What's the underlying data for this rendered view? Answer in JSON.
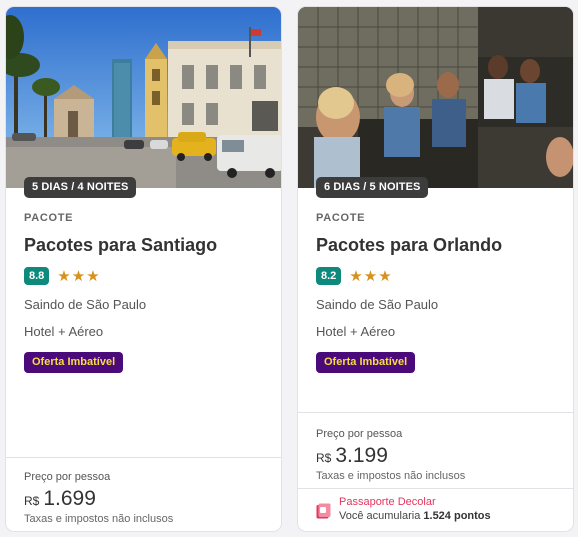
{
  "cards": [
    {
      "duration": "5 DIAS / 4 NOITES",
      "type_label": "PACOTE",
      "title": "Pacotes para Santiago",
      "score": "8.8",
      "stars": "★★★",
      "origin": "Saindo de São Paulo",
      "lodging": "Hotel + Aéreo",
      "offer": "Oferta Imbatível",
      "price_label": "Preço por pessoa",
      "currency": "R$",
      "price": "1.699",
      "taxes": "Taxas e impostos não inclusos"
    },
    {
      "duration": "6 DIAS / 5 NOITES",
      "type_label": "PACOTE",
      "title": "Pacotes para Orlando",
      "score": "8.2",
      "stars": "★★★",
      "origin": "Saindo de São Paulo",
      "lodging": "Hotel + Aéreo",
      "offer": "Oferta Imbatível",
      "price_label": "Preço por pessoa",
      "currency": "R$",
      "price": "3.199",
      "taxes": "Taxas e impostos não inclusos",
      "passport": {
        "title": "Passaporte Decolar",
        "text_prefix": "Você acumularia ",
        "points": "1.524 pontos"
      }
    }
  ],
  "colors": {
    "score_badge": "#0e8a7d",
    "stars": "#d7911c",
    "offer_bg": "#4b0a7a",
    "offer_text": "#fadc42",
    "passport_accent": "#e2365f"
  },
  "icons": {
    "star": "star-icon",
    "passport": "passport-icon"
  }
}
